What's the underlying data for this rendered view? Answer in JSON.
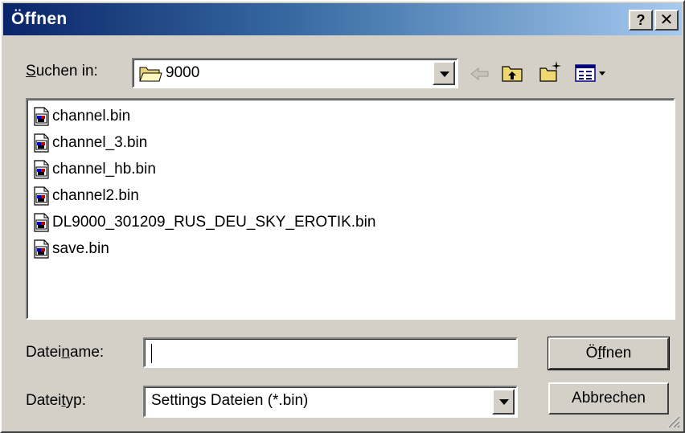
{
  "window": {
    "title": "Öffnen",
    "help_label": "?",
    "close_label": "✕"
  },
  "lookin": {
    "label_pre": "",
    "label_accel": "S",
    "label_post": "uchen in:",
    "value": "9000",
    "folder_icon": "open-folder-icon"
  },
  "toolbar": {
    "back_icon": "back-arrow-icon",
    "up_icon": "up-folder-icon",
    "new_folder_icon": "new-folder-icon",
    "view_icon": "view-menu-icon"
  },
  "files": [
    {
      "name": "channel.bin"
    },
    {
      "name": "channel_3.bin"
    },
    {
      "name": "channel_hb.bin"
    },
    {
      "name": "channel2.bin"
    },
    {
      "name": "DL9000_301209_RUS_DEU_SKY_EROTIK.bin"
    },
    {
      "name": "save.bin"
    }
  ],
  "filename": {
    "label_pre": "Datei",
    "label_accel": "n",
    "label_post": "ame:",
    "value": ""
  },
  "filetype": {
    "label_pre": "Datei",
    "label_accel": "t",
    "label_post": "yp:",
    "value": "Settings Dateien (*.bin)"
  },
  "buttons": {
    "open_pre": "Ö",
    "open_accel": "f",
    "open_post": "fnen",
    "cancel": "Abbrechen"
  }
}
